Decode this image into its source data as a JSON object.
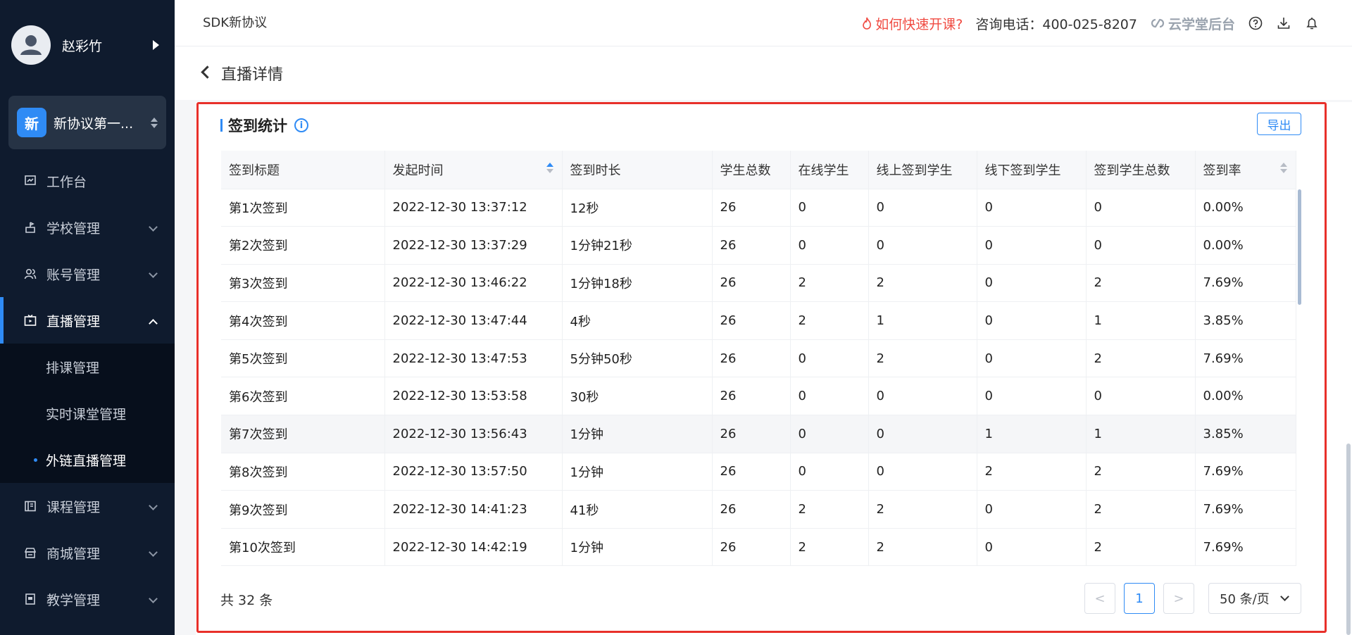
{
  "user": {
    "name": "赵彩竹"
  },
  "org": {
    "badge": "新",
    "name": "新协议第一..."
  },
  "menu": [
    {
      "label": "工作台",
      "icon": "dashboard-icon"
    },
    {
      "label": "学校管理",
      "icon": "school-icon"
    },
    {
      "label": "账号管理",
      "icon": "users-icon"
    },
    {
      "label": "直播管理",
      "icon": "live-icon"
    },
    {
      "label": "课程管理",
      "icon": "course-icon"
    },
    {
      "label": "商城管理",
      "icon": "shop-icon"
    },
    {
      "label": "教学管理",
      "icon": "teaching-icon"
    }
  ],
  "submenu": [
    {
      "label": "排课管理"
    },
    {
      "label": "实时课堂管理"
    },
    {
      "label": "外链直播管理"
    }
  ],
  "header": {
    "title": "SDK新协议",
    "hot_link": "如何快速开课?",
    "phone": "咨询电话：400-025-8207",
    "brand": "云学堂后台"
  },
  "page": {
    "back_title": "直播详情"
  },
  "section": {
    "title": "签到统计",
    "export_label": "导出"
  },
  "table": {
    "columns": [
      "签到标题",
      "发起时间",
      "签到时长",
      "学生总数",
      "在线学生",
      "线上签到学生",
      "线下签到学生",
      "签到学生总数",
      "签到率"
    ],
    "rows": [
      [
        "第1次签到",
        "2022-12-30 13:37:12",
        "12秒",
        "26",
        "0",
        "0",
        "0",
        "0",
        "0.00%"
      ],
      [
        "第2次签到",
        "2022-12-30 13:37:29",
        "1分钟21秒",
        "26",
        "0",
        "0",
        "0",
        "0",
        "0.00%"
      ],
      [
        "第3次签到",
        "2022-12-30 13:46:22",
        "1分钟18秒",
        "26",
        "2",
        "2",
        "0",
        "2",
        "7.69%"
      ],
      [
        "第4次签到",
        "2022-12-30 13:47:44",
        "4秒",
        "26",
        "2",
        "1",
        "0",
        "1",
        "3.85%"
      ],
      [
        "第5次签到",
        "2022-12-30 13:47:53",
        "5分钟50秒",
        "26",
        "0",
        "2",
        "0",
        "2",
        "7.69%"
      ],
      [
        "第6次签到",
        "2022-12-30 13:53:58",
        "30秒",
        "26",
        "0",
        "0",
        "0",
        "0",
        "0.00%"
      ],
      [
        "第7次签到",
        "2022-12-30 13:56:43",
        "1分钟",
        "26",
        "0",
        "0",
        "1",
        "1",
        "3.85%"
      ],
      [
        "第8次签到",
        "2022-12-30 13:57:50",
        "1分钟",
        "26",
        "0",
        "0",
        "2",
        "2",
        "7.69%"
      ],
      [
        "第9次签到",
        "2022-12-30 14:41:23",
        "41秒",
        "26",
        "2",
        "2",
        "0",
        "2",
        "7.69%"
      ],
      [
        "第10次签到",
        "2022-12-30 14:42:19",
        "1分钟",
        "26",
        "2",
        "2",
        "0",
        "2",
        "7.69%"
      ]
    ]
  },
  "footer": {
    "total": "共 32 条",
    "prev": "<",
    "page": "1",
    "next": ">",
    "page_size": "50 条/页"
  },
  "colors": {
    "accent": "#2f8bf5",
    "sidebar": "#0f1b2e",
    "highlight": "#e8302a",
    "hot": "#f04b42"
  }
}
